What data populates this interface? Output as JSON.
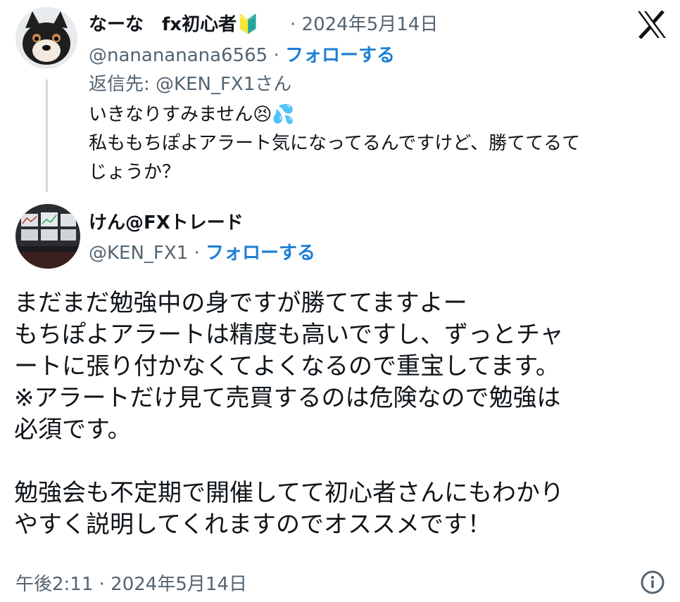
{
  "reply_tweet": {
    "display_name": "なーな　fx初心者",
    "beginner_mark": "🔰",
    "separator": "·",
    "date": "2024年5月14日",
    "handle": "@nanananana6565",
    "follow": "フォローする",
    "reply_to": "返信先: @KEN_FX1さん",
    "text_line1": "いきなりすみません",
    "emoji1": "😣",
    "emoji2": "💦",
    "text_line2": "私ももちぽよアラート気になってるんですけど、勝ててるて",
    "text_line3": "じょうか？"
  },
  "main_tweet": {
    "display_name": "けん@FXトレード",
    "handle": "@KEN_FX1",
    "separator": "·",
    "follow": "フォローする",
    "body_lines": [
      "まだまだ勉強中の身ですが勝ててますよー",
      "もちぽよアラートは精度も高いですし、ずっとチャ",
      "ートに張り付かなくてよくなるので重宝してます。",
      "※アラートだけ見て売買するのは危険なので勉強は",
      "必須です。",
      "勉強会も不定期で開催してて初心者さんにもわかり",
      "やすく説明してくれますのでオススメです！"
    ],
    "timestamp": "午後2:11 · 2024年5月14日"
  },
  "icons": {
    "platform_logo": "x-logo-icon",
    "info": "info-icon"
  },
  "colors": {
    "link": "#1d7fd6",
    "muted": "#536471",
    "thread_line": "#cfd9de"
  }
}
